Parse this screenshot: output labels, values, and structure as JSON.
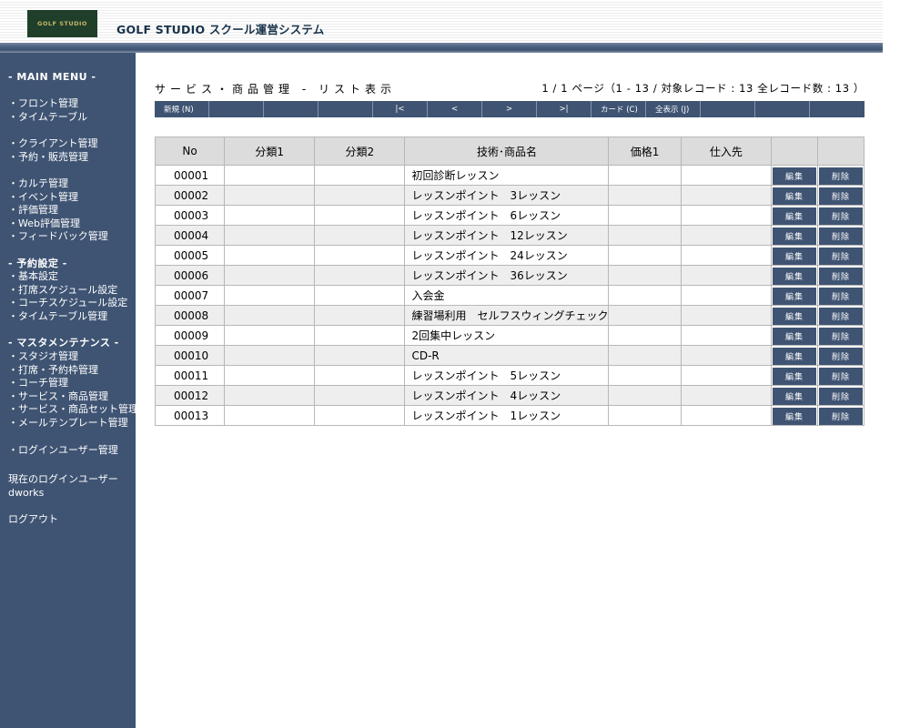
{
  "header": {
    "logo_text": "GOLF STUDIO",
    "app_title": "GOLF STUDIO スクール運営システム"
  },
  "sidebar": {
    "main_menu": "- MAIN MENU -",
    "group1": [
      "・フロント管理",
      "・タイムテーブル"
    ],
    "group2": [
      "・クライアント管理",
      "・予約・販売管理"
    ],
    "group3": [
      "・カルテ管理",
      "・イベント管理",
      "・評価管理",
      "・Web評価管理",
      "・フィードバック管理"
    ],
    "reserve_head": "- 予約設定 -",
    "group4": [
      "・基本設定",
      "・打席スケジュール設定",
      "・コーチスケジュール設定",
      "・タイムテーブル管理"
    ],
    "master_head": "- マスタメンテナンス -",
    "group5": [
      "・スタジオ管理",
      "・打席・予約枠管理",
      "・コーチ管理",
      "・サービス・商品管理",
      "・サービス・商品セット管理",
      "・メールテンプレート管理"
    ],
    "login_users": "・ログインユーザー管理",
    "current_user_label": "現在のログインユーザー",
    "current_user": "dworks",
    "logout": "ログアウト"
  },
  "main": {
    "heading": "サービス・商品管理 - リスト表示",
    "page_info": "1 / 1 ページ（1 - 13 / 対象レコード : 13 全レコード数 : 13 ）"
  },
  "toolbar": [
    {
      "label": "新規 (N)",
      "name": "new-button"
    },
    {
      "label": "",
      "name": "toolbar-blank-1"
    },
    {
      "label": "",
      "name": "toolbar-blank-2"
    },
    {
      "label": "",
      "name": "toolbar-blank-3"
    },
    {
      "label": "|<",
      "name": "first-page-button"
    },
    {
      "label": "<",
      "name": "prev-page-button"
    },
    {
      "label": ">",
      "name": "next-page-button"
    },
    {
      "label": ">|",
      "name": "last-page-button"
    },
    {
      "label": "カード (C)",
      "name": "card-button"
    },
    {
      "label": "全表示 (J)",
      "name": "show-all-button"
    },
    {
      "label": "",
      "name": "toolbar-blank-4"
    },
    {
      "label": "",
      "name": "toolbar-blank-5"
    },
    {
      "label": "",
      "name": "toolbar-blank-6"
    }
  ],
  "table": {
    "columns": [
      "No",
      "分類1",
      "分類2",
      "技術･商品名",
      "価格1",
      "仕入先",
      "",
      ""
    ],
    "edit_label": "編集",
    "delete_label": "削除",
    "rows": [
      {
        "no": "00001",
        "cat1": "",
        "cat2": "",
        "name": "初回診断レッスン",
        "price": "",
        "supplier": ""
      },
      {
        "no": "00002",
        "cat1": "",
        "cat2": "",
        "name": "レッスンポイント　3レッスン",
        "price": "",
        "supplier": ""
      },
      {
        "no": "00003",
        "cat1": "",
        "cat2": "",
        "name": "レッスンポイント　6レッスン",
        "price": "",
        "supplier": ""
      },
      {
        "no": "00004",
        "cat1": "",
        "cat2": "",
        "name": "レッスンポイント　12レッスン",
        "price": "",
        "supplier": ""
      },
      {
        "no": "00005",
        "cat1": "",
        "cat2": "",
        "name": "レッスンポイント　24レッスン",
        "price": "",
        "supplier": ""
      },
      {
        "no": "00006",
        "cat1": "",
        "cat2": "",
        "name": "レッスンポイント　36レッスン",
        "price": "",
        "supplier": ""
      },
      {
        "no": "00007",
        "cat1": "",
        "cat2": "",
        "name": "入会金",
        "price": "",
        "supplier": ""
      },
      {
        "no": "00008",
        "cat1": "",
        "cat2": "",
        "name": "練習場利用　セルフスウィングチェック",
        "price": "",
        "supplier": ""
      },
      {
        "no": "00009",
        "cat1": "",
        "cat2": "",
        "name": "2回集中レッスン",
        "price": "",
        "supplier": ""
      },
      {
        "no": "00010",
        "cat1": "",
        "cat2": "",
        "name": "CD-R",
        "price": "",
        "supplier": ""
      },
      {
        "no": "00011",
        "cat1": "",
        "cat2": "",
        "name": "レッスンポイント　5レッスン",
        "price": "",
        "supplier": ""
      },
      {
        "no": "00012",
        "cat1": "",
        "cat2": "",
        "name": "レッスンポイント　4レッスン",
        "price": "",
        "supplier": ""
      },
      {
        "no": "00013",
        "cat1": "",
        "cat2": "",
        "name": "レッスンポイント　1レッスン",
        "price": "",
        "supplier": ""
      }
    ]
  }
}
